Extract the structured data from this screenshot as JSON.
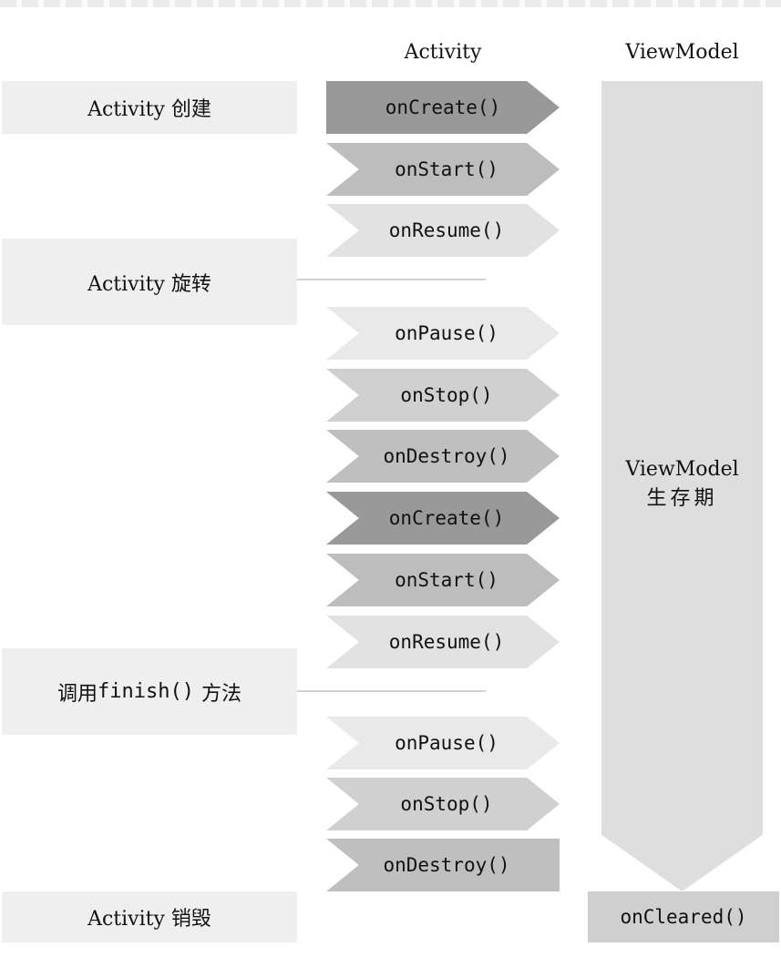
{
  "headers": {
    "activity": "Activity",
    "viewmodel": "ViewModel"
  },
  "events": [
    {
      "text": "Activity 创建"
    },
    {
      "text": "Activity 旋转"
    },
    {
      "prefix": "调用",
      "code": "finish()",
      "suffix": "方法"
    },
    {
      "text": "Activity 销毁"
    }
  ],
  "lifecycle_steps": [
    {
      "label": "onCreate()",
      "shade": "#999999",
      "shape": "first"
    },
    {
      "label": "onStart()",
      "shade": "#bdbdbd",
      "shape": "middle"
    },
    {
      "label": "onResume()",
      "shade": "#e2e2e2",
      "shape": "middle"
    },
    {
      "label": "onPause()",
      "shade": "#e9e9e9",
      "shape": "middle"
    },
    {
      "label": "onStop()",
      "shade": "#d0d0d0",
      "shape": "middle"
    },
    {
      "label": "onDestroy()",
      "shade": "#bfbfbf",
      "shape": "middle"
    },
    {
      "label": "onCreate()",
      "shade": "#999999",
      "shape": "middle"
    },
    {
      "label": "onStart()",
      "shade": "#bdbdbd",
      "shape": "middle"
    },
    {
      "label": "onResume()",
      "shade": "#e2e2e2",
      "shape": "middle"
    },
    {
      "label": "onPause()",
      "shade": "#e9e9e9",
      "shape": "middle"
    },
    {
      "label": "onStop()",
      "shade": "#d0d0d0",
      "shape": "middle"
    },
    {
      "label": "onDestroy()",
      "shade": "#bfbfbf",
      "shape": "last"
    }
  ],
  "viewmodel": {
    "title": "ViewModel",
    "subtitle": "生存期",
    "cleared": "onCleared()"
  },
  "colors": {
    "event_box": "#efefef",
    "viewmodel_bar": "#dedede",
    "cleared_box": "#cfcfcf"
  }
}
